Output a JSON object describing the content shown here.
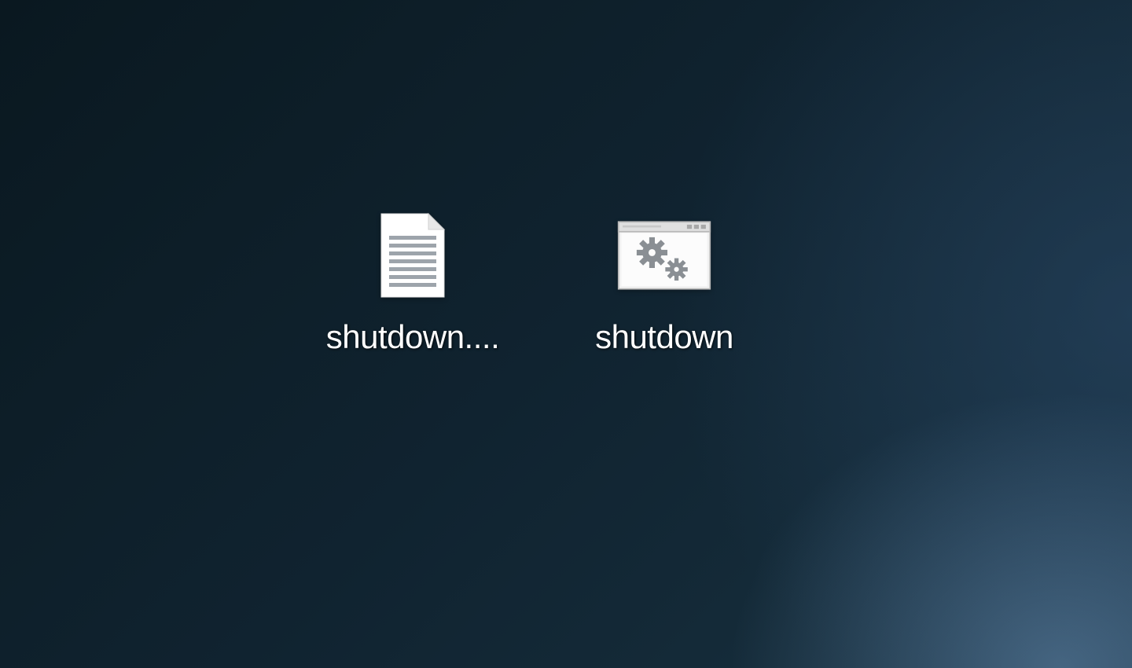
{
  "desktop": {
    "icons": [
      {
        "label": "shutdown....",
        "type": "text-file",
        "icon_name": "text-document-icon"
      },
      {
        "label": "shutdown",
        "type": "batch-file",
        "icon_name": "batch-file-icon"
      }
    ]
  }
}
